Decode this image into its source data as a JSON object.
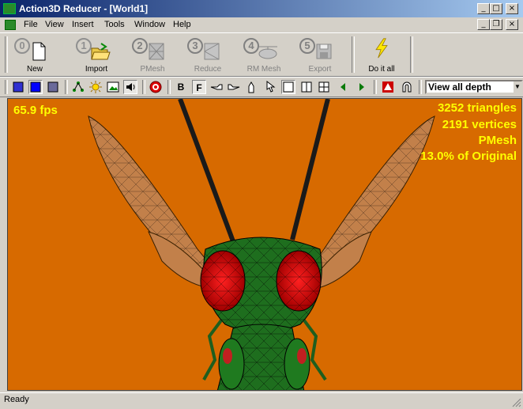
{
  "window": {
    "title": "Action3D Reducer - [World1]"
  },
  "title_buttons": {
    "minimize": "_",
    "maximize": "□",
    "close": "×"
  },
  "mdi_buttons": {
    "minimize": "_",
    "restore": "❐",
    "close": "×"
  },
  "menu": {
    "items": [
      "File",
      "View",
      "Insert",
      "Tools",
      "Window",
      "Help"
    ]
  },
  "toolbar": {
    "new": {
      "label": "New"
    },
    "import": {
      "label": "Import",
      "num": "1"
    },
    "pmesh": {
      "label": "PMesh",
      "num": "2"
    },
    "reduce": {
      "label": "Reduce",
      "num": "3"
    },
    "rmmesh": {
      "label": "RM Mesh",
      "num": "4"
    },
    "export": {
      "label": "Export",
      "num": "5"
    },
    "doitall": {
      "label": "Do it all"
    },
    "new_num": "0"
  },
  "toolbar2": {
    "bold_label": "B",
    "face_label": "F",
    "depth_value": "View all depth"
  },
  "viewport": {
    "fps": "65.9 fps",
    "triangles": "3252 triangles",
    "vertices": "2191 vertices",
    "mode": "PMesh",
    "percent": "13.0% of Original",
    "background_color": "#d76a00"
  },
  "status": {
    "text": "Ready"
  }
}
